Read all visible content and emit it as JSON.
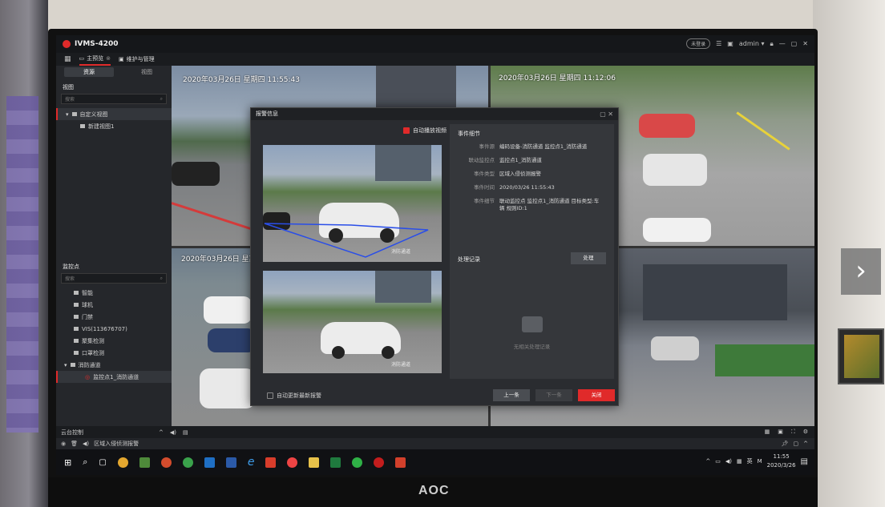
{
  "app": {
    "title": "IVMS-4200",
    "cloud": "未登录",
    "user": "admin ▾",
    "window_controls": [
      "—",
      "▢",
      "✕"
    ]
  },
  "tabs": [
    {
      "label": "主预览",
      "active": true
    },
    {
      "label": "维护与管理",
      "active": false
    }
  ],
  "sidebar": {
    "tabs": [
      {
        "label": "资源",
        "active": true
      },
      {
        "label": "视图",
        "active": false
      }
    ],
    "view_header": "视图",
    "view_search_placeholder": "搜索",
    "view_tree": [
      {
        "label": "自定义视图",
        "level": 0
      },
      {
        "label": "新建视图1",
        "level": 1
      }
    ],
    "camera_header": "监控点",
    "camera_search_placeholder": "搜索",
    "camera_tree": [
      {
        "label": "智能",
        "level": 1
      },
      {
        "label": "球机",
        "level": 1
      },
      {
        "label": "门禁",
        "level": 1
      },
      {
        "label": "VIS(113676707)",
        "level": 1
      },
      {
        "label": "聚集检测",
        "level": 1
      },
      {
        "label": "口罩检测",
        "level": 1
      },
      {
        "label": "消防通道",
        "level": 0
      },
      {
        "label": "监控点1_消防通道",
        "level": 2,
        "selected": true
      }
    ]
  },
  "cameras": [
    {
      "osd": "2020年03月26日 星期四 11:55:43"
    },
    {
      "osd": "2020年03月26日 星期四 11:12:06"
    },
    {
      "osd": "2020年03月26日 星期"
    }
  ],
  "dialog": {
    "title": "报警信息",
    "auto_play_label": "自动播放视频",
    "snapshot_top_label": "消防通道",
    "snapshot_bottom_label": "消防通道",
    "details_header": "事件细节",
    "details": [
      {
        "key": "事件源",
        "value": "编码设备-消防通道 监控点1_消防通道"
      },
      {
        "key": "联动监控点",
        "value": "监控点1_消防通道"
      },
      {
        "key": "事件类型",
        "value": "区域入侵侦测报警"
      },
      {
        "key": "事件时间",
        "value": "2020/03/26 11:55:43"
      },
      {
        "key": "事件细节",
        "value": "联动监控点 监控点1_消防通道 目标类型:车辆 规则ID:1"
      }
    ],
    "record_header": "处理记录",
    "handle_button": "处理",
    "empty_text": "无相关处理记录",
    "auto_refresh_label": "自动更新最新报警",
    "prev_button": "上一条",
    "next_button": "下一条",
    "close_button": "关闭"
  },
  "ptz_label": "云台控制",
  "alarm_bar_text": "区域入侵侦测报警",
  "clock": {
    "time": "11:55",
    "date": "2020/3/26"
  },
  "tray_lang": "英",
  "monitor_brand": "AOC",
  "colors": {
    "accent": "#e02a2a",
    "dialog_bg": "#2a2c30"
  }
}
